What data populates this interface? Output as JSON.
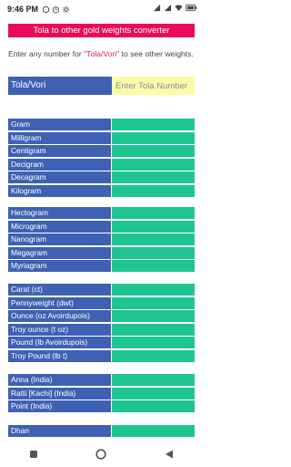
{
  "status_bar": {
    "time": "9:46 PM",
    "left_icons": [
      "notification-icon",
      "alarm-icon",
      "settings-icon"
    ],
    "right_icons": [
      "signal-icon",
      "wifi-icon",
      "battery-icon"
    ]
  },
  "title": "Tola to other gold weights converter",
  "instructions": {
    "before": "Enter any number for ",
    "highlight": "\"Tola/Vori\"",
    "after": " to see other weights."
  },
  "input": {
    "label": "Tola/Vori",
    "placeholder": "Enter Tola Number"
  },
  "groups": [
    {
      "rows": [
        {
          "label": "Gram",
          "value": ""
        },
        {
          "label": "Milligram",
          "value": ""
        },
        {
          "label": "Centigram",
          "value": ""
        },
        {
          "label": "Decigram",
          "value": ""
        },
        {
          "label": "Decagram",
          "value": ""
        },
        {
          "label": "Kilogram",
          "value": ""
        }
      ]
    },
    {
      "rows": [
        {
          "label": "Hectogram",
          "value": ""
        },
        {
          "label": "Microgram",
          "value": ""
        },
        {
          "label": "Nanogram",
          "value": ""
        },
        {
          "label": "Megagram",
          "value": ""
        },
        {
          "label": "Myriagram",
          "value": ""
        }
      ]
    },
    {
      "rows": [
        {
          "label": "Carat (ct)",
          "value": ""
        },
        {
          "label": "Pennyweight (dwt)",
          "value": ""
        },
        {
          "label": "Ounce (oz Avoirdupois)",
          "value": ""
        },
        {
          "label": "Troy ounce (t oz)",
          "value": ""
        },
        {
          "label": "Pound (lb Avoirdupois)",
          "value": ""
        },
        {
          "label": "Troy Pound (lb t)",
          "value": ""
        }
      ]
    },
    {
      "rows": [
        {
          "label": "Anna (India)",
          "value": ""
        },
        {
          "label": "Ratti [Kachi] (India)",
          "value": ""
        },
        {
          "label": "Point (India)",
          "value": ""
        }
      ]
    },
    {
      "rows": [
        {
          "label": "Dhan",
          "value": ""
        }
      ]
    }
  ],
  "colors": {
    "title_bg": "#ea0a5b",
    "label_bg": "#3f61b3",
    "value_bg": "#1ec591",
    "input_bg": "#fcfaa6"
  },
  "nav_bar": [
    "recent-apps-icon",
    "home-icon",
    "back-icon"
  ]
}
